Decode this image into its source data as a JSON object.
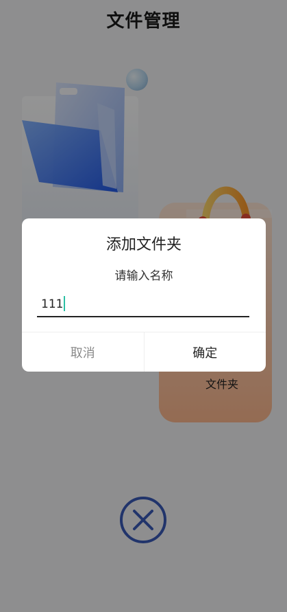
{
  "page": {
    "title": "文件管理",
    "folder_label": "文件夹"
  },
  "dialog": {
    "title": "添加文件夹",
    "subtitle": "请输入名称",
    "input_value": "111",
    "cancel_label": "取消",
    "confirm_label": "确定"
  },
  "icons": {
    "close": "close-circle-icon",
    "folder": "folder-illustration",
    "bag": "bag-illustration"
  },
  "colors": {
    "overlay": "rgba(0,0,0,0.42)",
    "caret": "#2bbfa4",
    "close_icon": "#3a5ab8"
  }
}
